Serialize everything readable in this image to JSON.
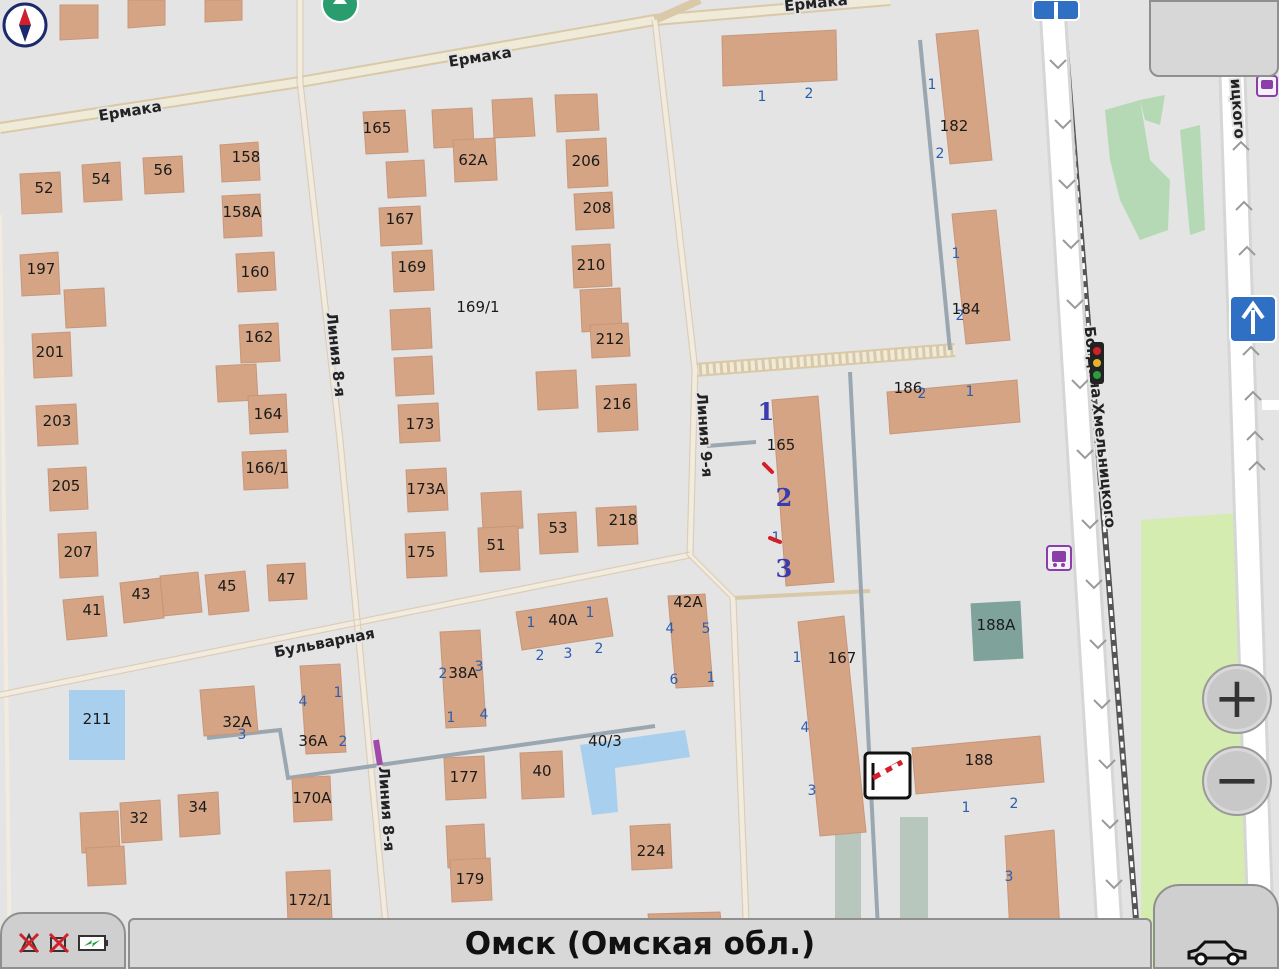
{
  "map": {
    "streets": [
      {
        "name": "Ермака",
        "id": "yermaka-west"
      },
      {
        "name": "Ермака",
        "id": "yermaka-mid"
      },
      {
        "name": "Ермака",
        "id": "yermaka-east"
      },
      {
        "name": "Линия 8-я",
        "id": "liniya8-north"
      },
      {
        "name": "Линия 8-я",
        "id": "liniya8-south"
      },
      {
        "name": "Линия 9-я",
        "id": "liniya9"
      },
      {
        "name": "Бульварная",
        "id": "bulvarnaya"
      },
      {
        "name": "Богдана Хмельницкого",
        "id": "khmelnitskogo"
      },
      {
        "name": "ицкого",
        "id": "khmelnitskogo-2"
      }
    ],
    "house_numbers": [
      "165",
      "62А",
      "206",
      "158",
      "52",
      "54",
      "56",
      "158А",
      "208",
      "167",
      "210",
      "197",
      "160",
      "169",
      "169/1",
      "212",
      "201",
      "162",
      "173",
      "216",
      "203",
      "164",
      "166/1",
      "173А",
      "218",
      "53",
      "205",
      "51",
      "207",
      "175",
      "47",
      "43",
      "45",
      "41",
      "42А",
      "40А",
      "211",
      "32А",
      "36А",
      "38А",
      "40/3",
      "177",
      "40",
      "170А",
      "32",
      "34",
      "224",
      "179",
      "172/1",
      "182",
      "184",
      "186",
      "188А",
      "188",
      "167"
    ],
    "entrance_numbers": [
      "1",
      "2",
      "1",
      "2",
      "1",
      "2",
      "1",
      "2",
      "1",
      "2",
      "1",
      "3",
      "2",
      "4",
      "5",
      "6",
      "1",
      "2",
      "3",
      "1",
      "4",
      "4",
      "1",
      "2",
      "3",
      "1",
      "4",
      "3",
      "1",
      "2",
      "3",
      "1",
      "2",
      "1"
    ],
    "entrance_large": [
      "1",
      "2",
      "3"
    ],
    "building_165": "165",
    "colors": {
      "background": "#e4e4e4",
      "building": "#d4a484",
      "building_stroke": "#c8967a",
      "road": "#f2f2f2",
      "road_edge": "#d6c6a8",
      "path": "#9aa7b0",
      "water": "#a8cfee",
      "park": "#d4ecb0",
      "green": "#b4d9b4",
      "building_teal": "#7fa39a"
    }
  },
  "ui": {
    "zoom_in": "+",
    "zoom_out": "−",
    "city": "Омск (Омская обл.)",
    "icons": [
      "compass-icon",
      "one-way-arrow-icon",
      "traffic-light-icon",
      "bus-stop-icon",
      "barrier-icon",
      "gps-off-icon",
      "sound-off-icon",
      "battery-charging-icon",
      "car-icon"
    ]
  }
}
